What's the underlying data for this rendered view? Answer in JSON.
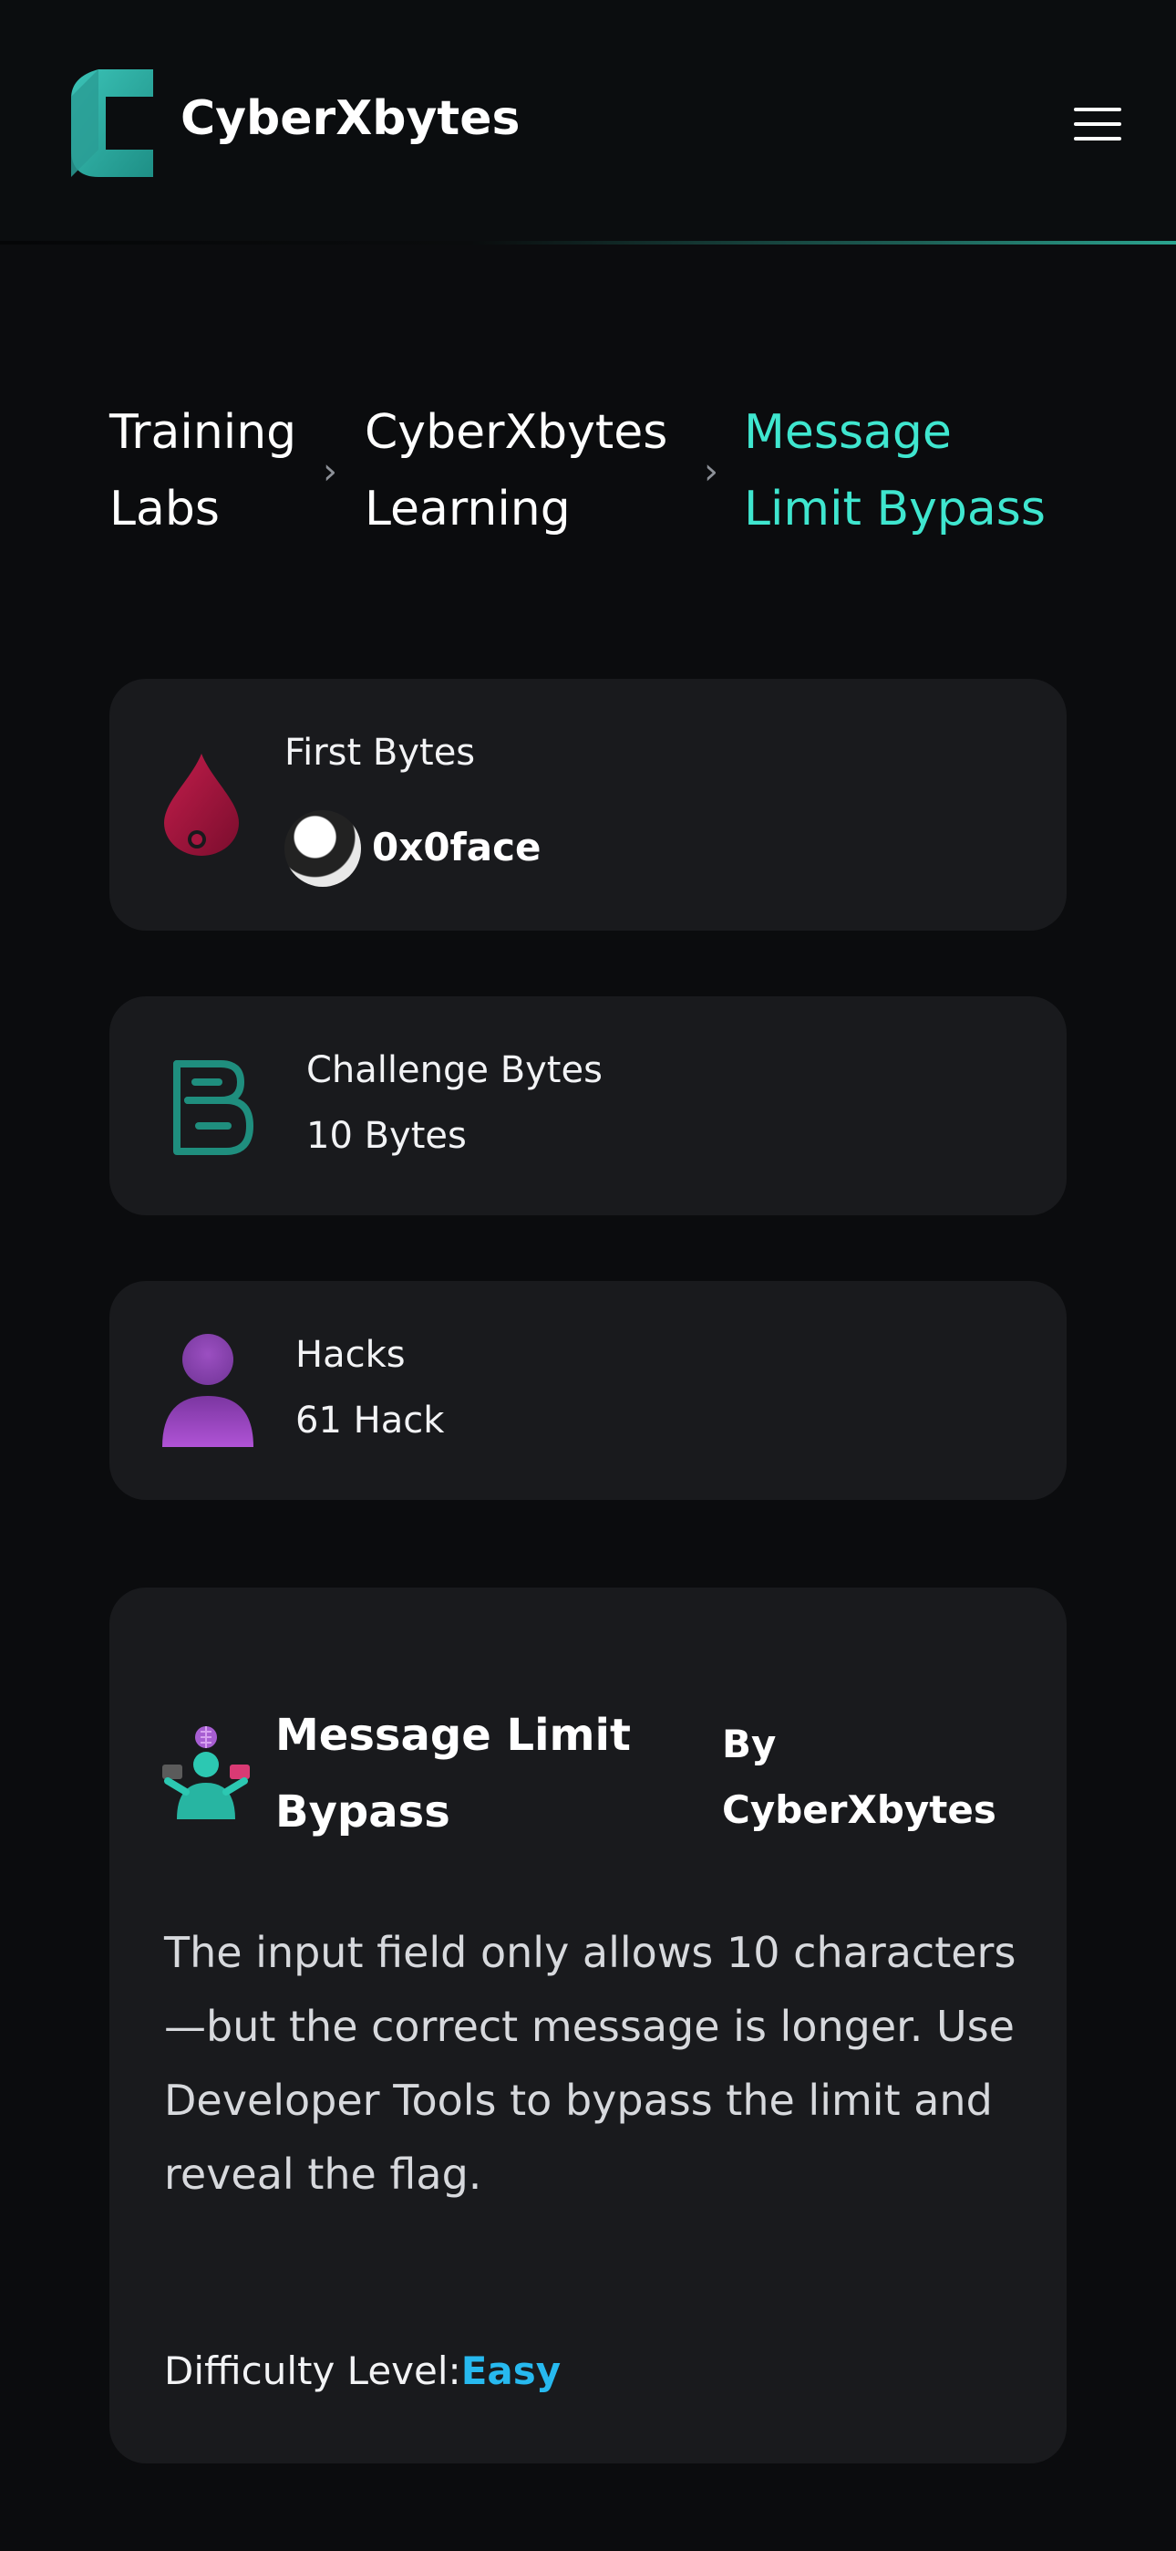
{
  "header": {
    "brand": "CyberXbytes",
    "menu_icon": "hamburger-menu-icon",
    "accent_color": "#3fe6cf"
  },
  "breadcrumb": {
    "items": [
      {
        "line1": "Training",
        "line2": "Labs"
      },
      {
        "line1": "CyberXbytes",
        "line2": "Learning"
      },
      {
        "line1": "Message",
        "line2": "Limit Bypass"
      }
    ],
    "separator": "›"
  },
  "stats": {
    "first_bytes": {
      "label": "First Bytes",
      "user": "0x0face",
      "icon": "blood-drop-icon"
    },
    "challenge_bytes": {
      "label": "Challenge Bytes",
      "value": "10 Bytes",
      "icon": "bytes-logo-icon"
    },
    "hacks": {
      "label": "Hacks",
      "value": "61 Hack",
      "icon": "user-icon"
    }
  },
  "challenge": {
    "title_line1": "Message Limit",
    "title_line2": "Bypass",
    "author_line1": "By",
    "author_line2": "CyberXbytes",
    "description_lines": [
      "The input field only allows 10 characters",
      "—but the correct message is longer. Use",
      "Developer Tools to bypass the limit and",
      "reveal the flag."
    ],
    "difficulty_label": "Difficulty Level:",
    "difficulty_value": "Easy",
    "difficulty_color": "#27b9ef"
  }
}
